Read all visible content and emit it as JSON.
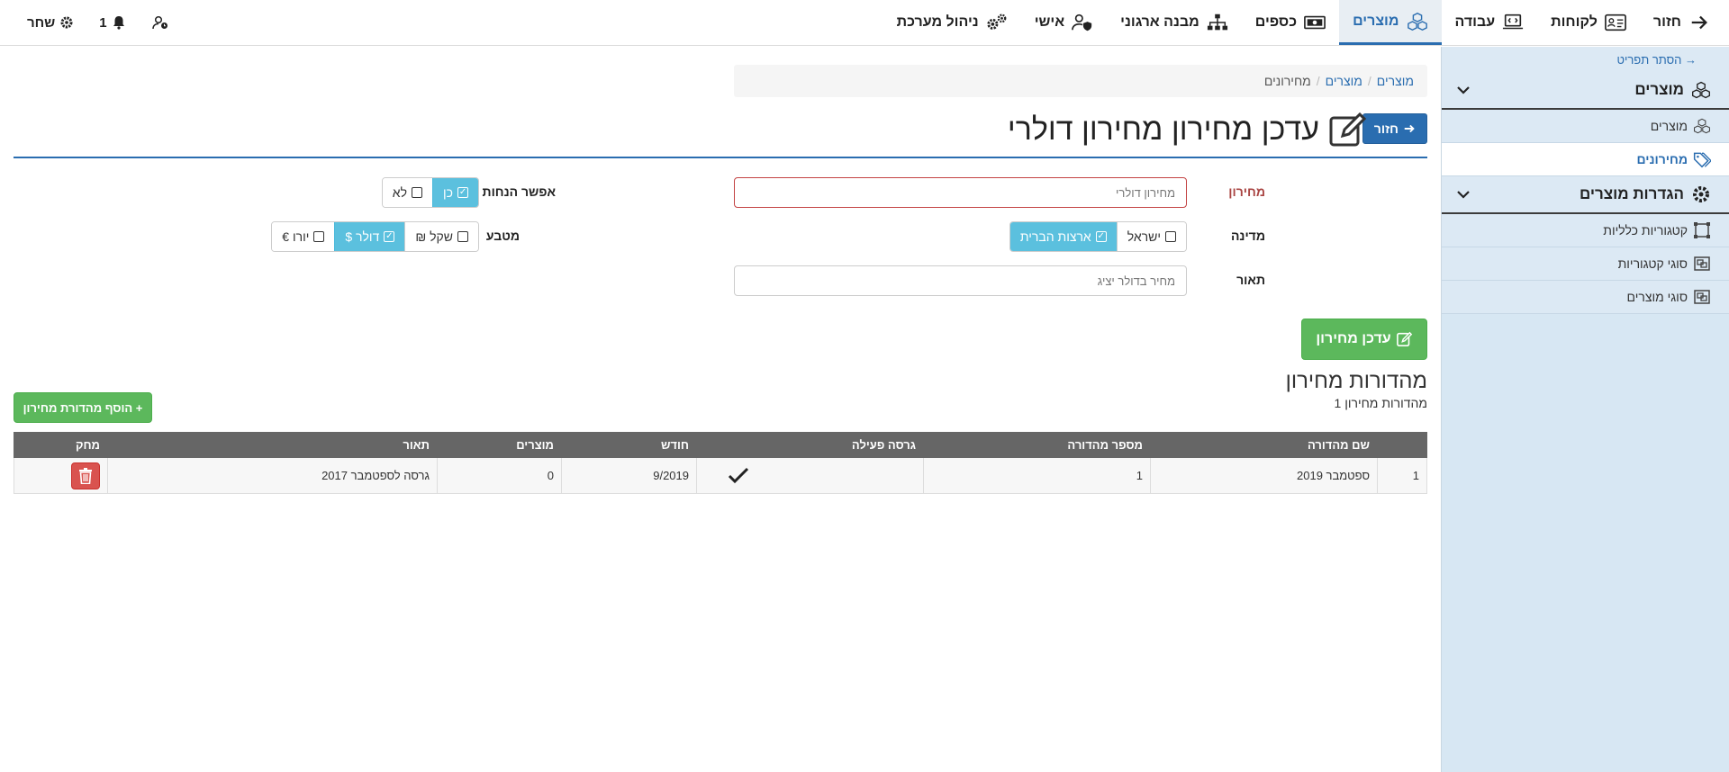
{
  "topnav": {
    "items": [
      {
        "label": "חזור",
        "icon": "arrow-right-icon"
      },
      {
        "label": "לקוחות",
        "icon": "contact-card-icon"
      },
      {
        "label": "עבודה",
        "icon": "laptop-code-icon"
      },
      {
        "label": "מוצרים",
        "icon": "cubes-icon",
        "active": true
      },
      {
        "label": "כספים",
        "icon": "money-bill-icon"
      },
      {
        "label": "מבנה ארגוני",
        "icon": "org-chart-icon"
      },
      {
        "label": "אישי",
        "icon": "user-shield-icon"
      },
      {
        "label": "ניהול מערכת",
        "icon": "gears-icon"
      }
    ],
    "user_name": "שחר",
    "notifications_count": "1"
  },
  "sidebar": {
    "hide_label": "→ הסתר תפריט",
    "sections": [
      {
        "title": "מוצרים",
        "items": [
          {
            "label": "מוצרים",
            "icon": "cubes-icon"
          },
          {
            "label": "מחירונים",
            "icon": "tags-icon",
            "active": true
          }
        ]
      },
      {
        "title": "הגדרות מוצרים",
        "items": [
          {
            "label": "קטגוריות כלליות",
            "icon": "vector-square-icon"
          },
          {
            "label": "סוגי קטגוריות",
            "icon": "object-group-icon"
          },
          {
            "label": "סוגי מוצרים",
            "icon": "object-group-icon"
          }
        ]
      }
    ]
  },
  "breadcrumb": [
    "מוצרים",
    "מוצרים",
    "מחירונים"
  ],
  "page": {
    "back_label": "חזור",
    "title": "עדכן מחירון מחירון דולרי"
  },
  "form": {
    "pricelist_label": "מחירון",
    "pricelist_value": "מחירון דולרי",
    "country_label": "מדינה",
    "country_options": [
      "ישראל",
      "ארצות הברית"
    ],
    "country_selected": "ארצות הברית",
    "description_label": "תאור",
    "description_value": "מחיר בדולר יציג",
    "allow_discounts_label": "אפשר הנחות",
    "allow_options": [
      "כן",
      "לא"
    ],
    "allow_selected": "כן",
    "currency_label": "מטבע",
    "currency_options": [
      "שקל ₪",
      "דולר $",
      "יורו €"
    ],
    "currency_selected": "דולר $",
    "update_button": "עדכן מחירון"
  },
  "versions": {
    "title": "מהדורות מחירון",
    "subtitle": "מהדורות מחירון 1",
    "add_button": "+ הוסף מהדורת מחירון",
    "columns": [
      "",
      "שם מהדורה",
      "מספר מהדורה",
      "גרסה פעילה",
      "חודש",
      "מוצרים",
      "תאור",
      "מחק"
    ],
    "rows": [
      {
        "index": "1",
        "name": "ספטמבר 2019",
        "number": "1",
        "active": true,
        "month": "9/2019",
        "products": "0",
        "description": "גרסה לספטמבר 2017"
      }
    ]
  },
  "colors": {
    "primary": "#2a6db0",
    "success": "#5cb85c",
    "info": "#5bc0de",
    "danger": "#d9534f",
    "sidebar": "#d7e7f3"
  }
}
